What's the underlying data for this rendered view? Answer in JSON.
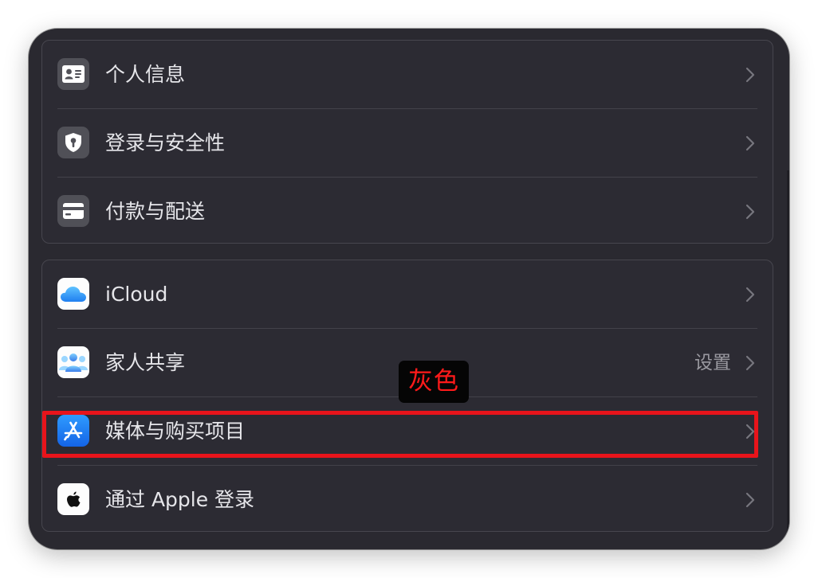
{
  "groups": [
    {
      "rows": [
        {
          "label": "个人信息",
          "icon": "contact-card-icon"
        },
        {
          "label": "登录与安全性",
          "icon": "shield-lock-icon"
        },
        {
          "label": "付款与配送",
          "icon": "credit-card-icon"
        }
      ]
    },
    {
      "rows": [
        {
          "label": "iCloud",
          "icon": "icloud-icon"
        },
        {
          "label": "家人共享",
          "icon": "family-sharing-icon",
          "value": "设置"
        },
        {
          "label": "媒体与购买项目",
          "icon": "app-store-icon"
        },
        {
          "label": "通过 Apple 登录",
          "icon": "apple-logo-icon"
        }
      ]
    }
  ],
  "annotation": {
    "text": "灰色",
    "color": "#ff1a1a",
    "highlight_color": "#e8141b"
  },
  "colors": {
    "window_background": "#2a2930",
    "group_background": "#2c2b33",
    "label_text": "#e6e6ea",
    "secondary_text": "#9a99a0"
  }
}
